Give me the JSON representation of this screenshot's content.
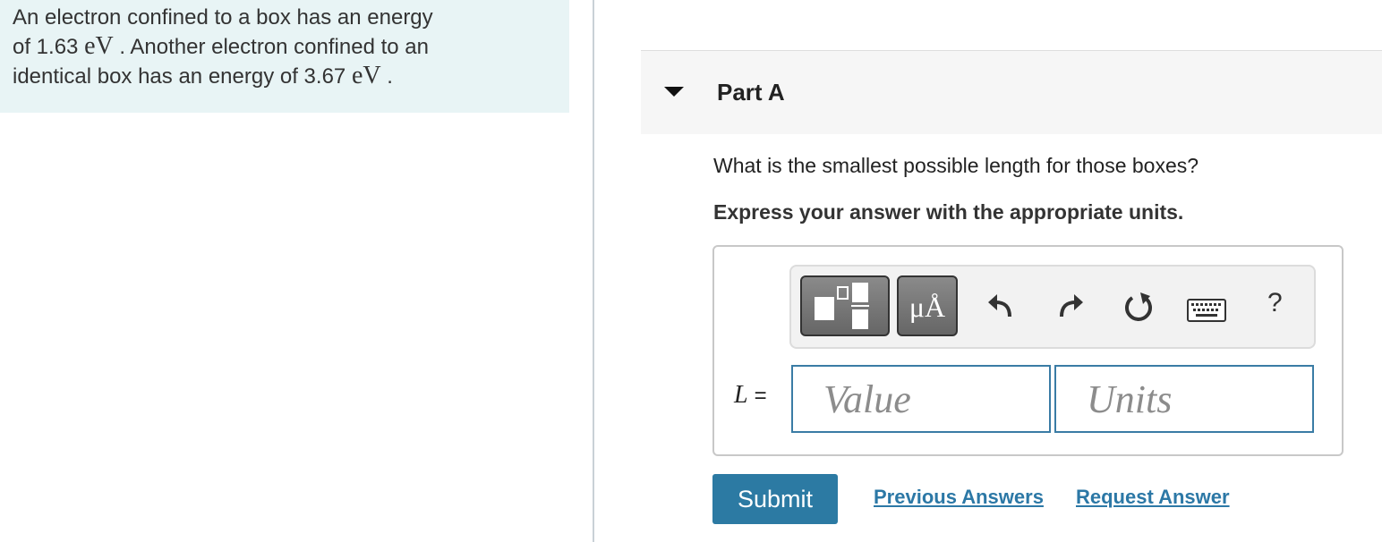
{
  "problem": {
    "line1": "An electron confined to a box has an energy",
    "line2_pre": "of 1.63 ",
    "unit": "eV",
    "line2_post": " . Another electron confined to an",
    "line3_pre": "identical box has an energy of 3.67 ",
    "line3_post": " ."
  },
  "part": {
    "title": "Part A",
    "question": "What is the smallest possible length for those boxes?",
    "instruction": "Express your answer with the appropriate units."
  },
  "toolbar": {
    "units_label": "μÅ",
    "help_label": "?",
    "icons": [
      "templates-icon",
      "units-icon",
      "undo-icon",
      "redo-icon",
      "reset-icon",
      "keyboard-icon",
      "help-icon"
    ]
  },
  "answer": {
    "variable": "L",
    "equals": "=",
    "value_placeholder": "Value",
    "units_placeholder": "Units"
  },
  "actions": {
    "submit_label": "Submit",
    "previous_answers_label": "Previous Answers",
    "request_answer_label": "Request Answer"
  },
  "colors": {
    "problem_bg": "#e8f4f5",
    "accent": "#2c7aa3",
    "field_border": "#3a7ca5"
  }
}
